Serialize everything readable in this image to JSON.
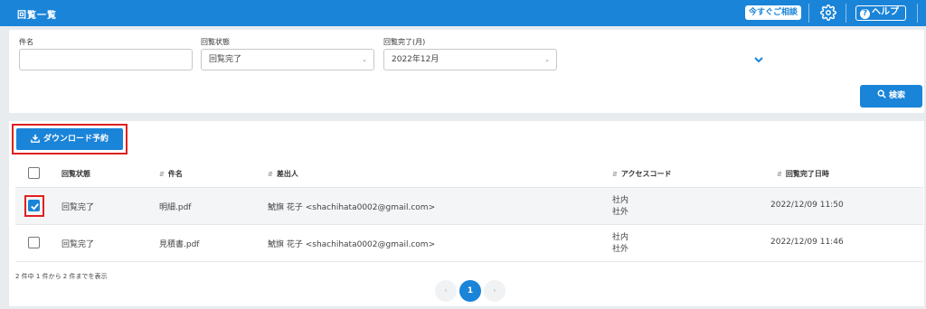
{
  "header": {
    "title": "回覧一覧",
    "consult_label": "今すぐご相談",
    "help_label": "ヘルプ",
    "accent_color": "#1a84d8"
  },
  "search": {
    "subject_label": "件名",
    "subject_value": "",
    "status_label": "回覧状態",
    "status_value": "回覧完了",
    "completion_label": "回覧完了(月)",
    "completion_value": "2022年12月",
    "search_button": "検索"
  },
  "results": {
    "download_button": "ダウンロード予約",
    "columns": [
      "回覧状態",
      "件名",
      "差出人",
      "アクセスコード",
      "回覧完了日時"
    ],
    "rows": [
      {
        "checked": true,
        "status": "回覧完了",
        "subject": "明細.pdf",
        "sender": "鯱旗 花子 <shachihata0002@gmail.com>",
        "access1": "社内",
        "access2": "社外",
        "completed": "2022/12/09 11:50"
      },
      {
        "checked": false,
        "status": "回覧完了",
        "subject": "見積書.pdf",
        "sender": "鯱旗 花子 <shachihata0002@gmail.com>",
        "access1": "社内",
        "access2": "社外",
        "completed": "2022/12/09 11:46"
      }
    ],
    "count_text": "2 件中 1 件から 2 件までを表示",
    "current_page": "1"
  }
}
